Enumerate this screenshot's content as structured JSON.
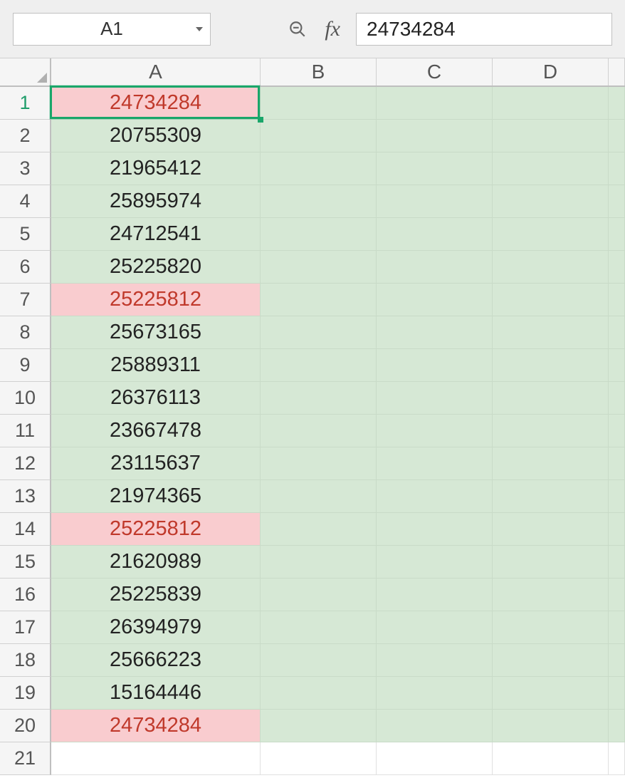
{
  "toolbar": {
    "name_box_value": "A1",
    "formula_bar_value": "24734284",
    "fx_label": "fx"
  },
  "columns": [
    "A",
    "B",
    "C",
    "D"
  ],
  "active_cell": "A1",
  "rows": [
    {
      "num": "1",
      "a": "24734284",
      "highlight": true,
      "active": true
    },
    {
      "num": "2",
      "a": "20755309",
      "highlight": false,
      "active": false
    },
    {
      "num": "3",
      "a": "21965412",
      "highlight": false,
      "active": false
    },
    {
      "num": "4",
      "a": "25895974",
      "highlight": false,
      "active": false
    },
    {
      "num": "5",
      "a": "24712541",
      "highlight": false,
      "active": false
    },
    {
      "num": "6",
      "a": "25225820",
      "highlight": false,
      "active": false
    },
    {
      "num": "7",
      "a": "25225812",
      "highlight": true,
      "active": false
    },
    {
      "num": "8",
      "a": "25673165",
      "highlight": false,
      "active": false
    },
    {
      "num": "9",
      "a": "25889311",
      "highlight": false,
      "active": false
    },
    {
      "num": "10",
      "a": "26376113",
      "highlight": false,
      "active": false
    },
    {
      "num": "11",
      "a": "23667478",
      "highlight": false,
      "active": false
    },
    {
      "num": "12",
      "a": "23115637",
      "highlight": false,
      "active": false
    },
    {
      "num": "13",
      "a": "21974365",
      "highlight": false,
      "active": false
    },
    {
      "num": "14",
      "a": "25225812",
      "highlight": true,
      "active": false
    },
    {
      "num": "15",
      "a": "21620989",
      "highlight": false,
      "active": false
    },
    {
      "num": "16",
      "a": "25225839",
      "highlight": false,
      "active": false
    },
    {
      "num": "17",
      "a": "26394979",
      "highlight": false,
      "active": false
    },
    {
      "num": "18",
      "a": "25666223",
      "highlight": false,
      "active": false
    },
    {
      "num": "19",
      "a": "15164446",
      "highlight": false,
      "active": false
    },
    {
      "num": "20",
      "a": "24734284",
      "highlight": true,
      "active": false
    },
    {
      "num": "21",
      "a": "",
      "highlight": false,
      "active": false,
      "last": true
    }
  ],
  "colors": {
    "selection_green": "#d6e8d5",
    "highlight_pink": "#f9cccf",
    "highlight_text": "#c0392b",
    "active_border": "#1aa66a"
  }
}
